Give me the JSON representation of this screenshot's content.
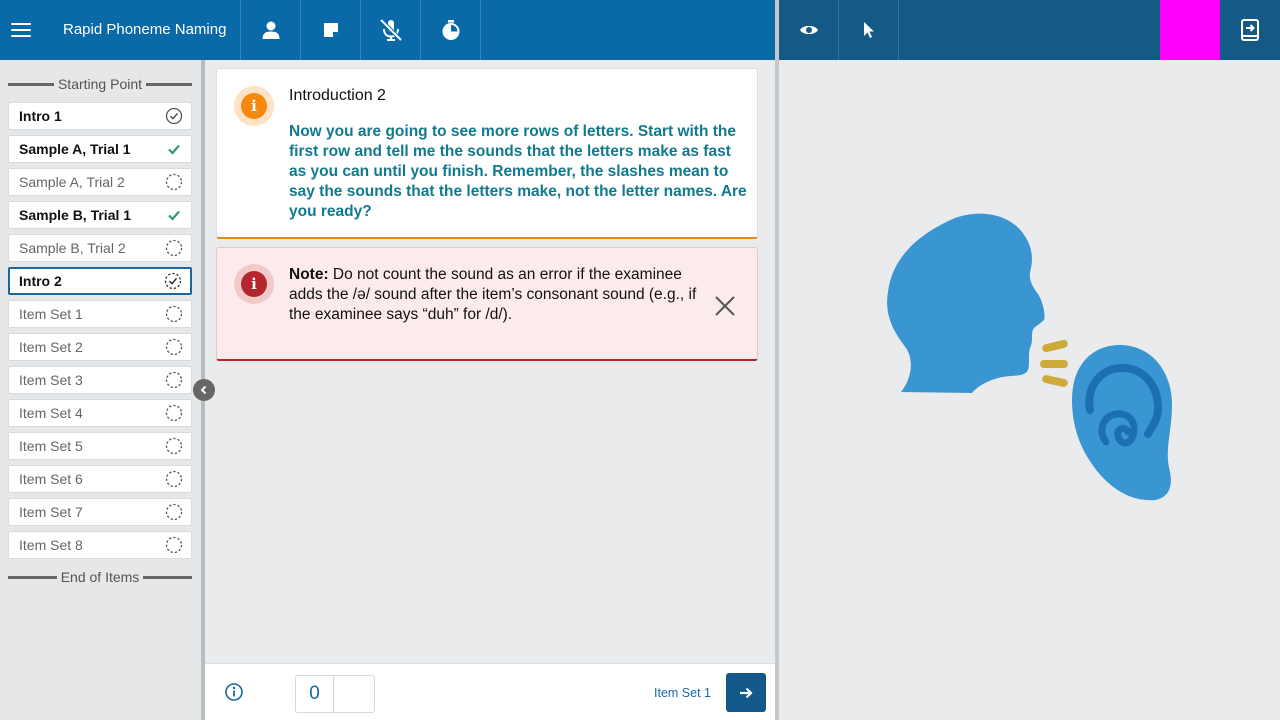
{
  "app": {
    "title": "Rapid Phoneme Naming"
  },
  "toolbar": {
    "icons": [
      "menu-icon",
      "person-icon",
      "note-icon",
      "mic-off-icon",
      "timer-icon"
    ],
    "right_icons": [
      "eye-icon",
      "pointer-icon",
      "exit-icon"
    ],
    "accent_colors": {
      "topbar": "#0a6aa8",
      "right_topbar": "#155a86",
      "magenta_block": "#ff00ff"
    }
  },
  "sidebar": {
    "start_label": "Starting Point",
    "end_label": "End of Items",
    "items": [
      {
        "label": "Intro 1",
        "status": "checked-circle"
      },
      {
        "label": "Sample A, Trial 1",
        "status": "check"
      },
      {
        "label": "Sample A, Trial 2",
        "status": "pending"
      },
      {
        "label": "Sample B, Trial 1",
        "status": "check"
      },
      {
        "label": "Sample B, Trial 2",
        "status": "pending"
      },
      {
        "label": "Intro 2",
        "status": "in-progress"
      },
      {
        "label": "Item Set 1",
        "status": "pending"
      },
      {
        "label": "Item Set 2",
        "status": "pending"
      },
      {
        "label": "Item Set 3",
        "status": "pending"
      },
      {
        "label": "Item Set 4",
        "status": "pending"
      },
      {
        "label": "Item Set 5",
        "status": "pending"
      },
      {
        "label": "Item Set 6",
        "status": "pending"
      },
      {
        "label": "Item Set 7",
        "status": "pending"
      },
      {
        "label": "Item Set 8",
        "status": "pending"
      }
    ]
  },
  "intro_card": {
    "title": "Introduction 2",
    "body": "Now you are going to see more rows of letters. Start with the first row and tell me the sounds that the letters make as fast as you can until you finish. Remember, the slashes mean to say the sounds that the letters make, not the letter names. Are you ready?"
  },
  "note_card": {
    "label": "Note:",
    "text": " Do not count the sound as an error if the examinee adds the /ə/ sound after the item’s consonant sound (e.g., if the examinee says “duh” for /d/)."
  },
  "footer": {
    "score": "0",
    "next_label": "Item Set 1"
  }
}
